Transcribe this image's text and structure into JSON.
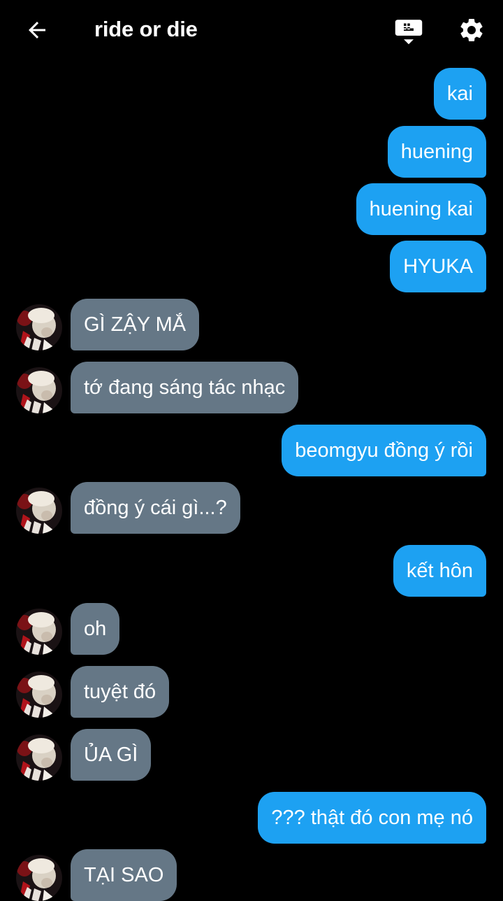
{
  "header": {
    "title": "ride or die"
  },
  "colors": {
    "background": "#000000",
    "sent_bubble": "#1da1f2",
    "received_bubble": "#657786",
    "text": "#ffffff"
  },
  "icons": {
    "back": "arrow-left-icon",
    "keyboard": "keyboard-icon",
    "settings": "gear-icon"
  },
  "messages": [
    {
      "from": "me",
      "text": "kai"
    },
    {
      "from": "me",
      "text": "huening"
    },
    {
      "from": "me",
      "text": "huening kai"
    },
    {
      "from": "me",
      "text": "HYUKA"
    },
    {
      "from": "them",
      "text": "GÌ ZẬY MẮ"
    },
    {
      "from": "them",
      "text": "tớ đang sáng tác nhạc"
    },
    {
      "from": "me",
      "text": "beomgyu đồng ý rồi"
    },
    {
      "from": "them",
      "text": "đồng ý cái gì...?"
    },
    {
      "from": "me",
      "text": "kết hôn"
    },
    {
      "from": "them",
      "text": "oh"
    },
    {
      "from": "them",
      "text": "tuyệt đó"
    },
    {
      "from": "them",
      "text": "ỦA GÌ"
    },
    {
      "from": "me",
      "text": "??? thật đó con mẹ nó"
    },
    {
      "from": "them",
      "text": "TẠI SAO"
    }
  ]
}
